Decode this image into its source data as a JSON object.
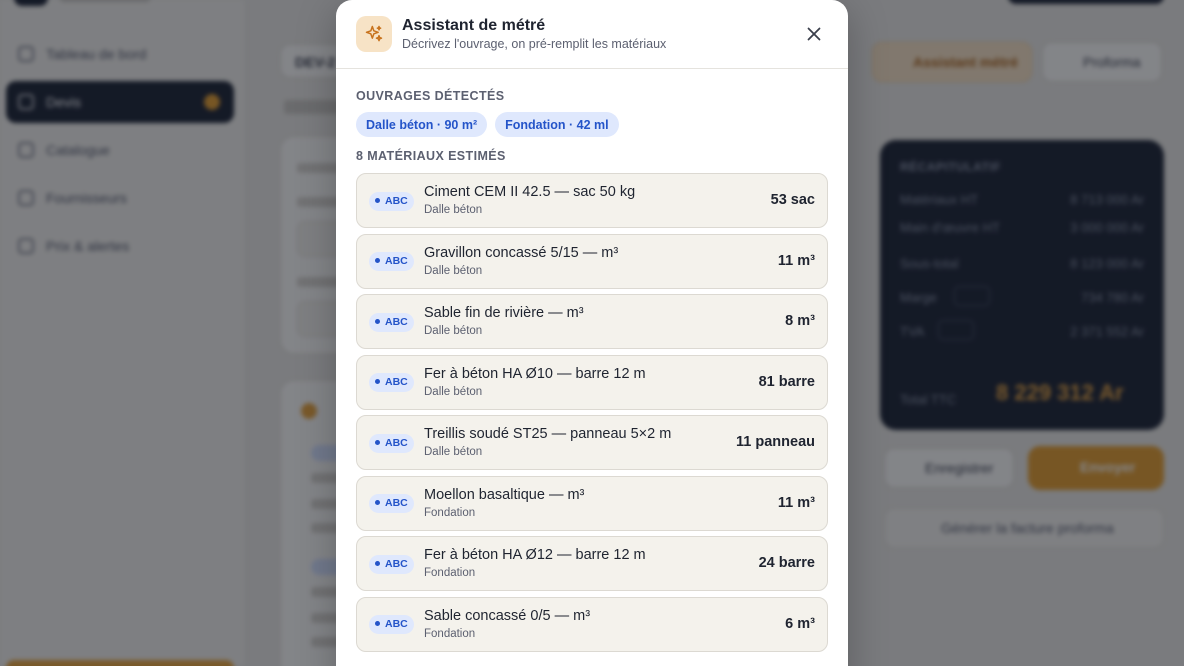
{
  "background": {
    "sidebar": {
      "items": [
        {
          "label": "Tableau de bord",
          "icon": "grid-icon"
        },
        {
          "label": "Devis",
          "icon": "document-icon",
          "active": true
        },
        {
          "label": "Catalogue",
          "icon": "box-icon"
        },
        {
          "label": "Fournisseurs",
          "icon": "truck-icon"
        },
        {
          "label": "Prix & alertes",
          "icon": "trend-icon"
        }
      ]
    },
    "main": {
      "doc_title": "DEV-2",
      "ai_button": "Assistant métré",
      "proforma_button": "Proforma",
      "recap": {
        "title": "RÉCAPITULATIF",
        "lines": [
          {
            "label": "Matériaux HT",
            "value": "8 713 000 Ar"
          },
          {
            "label": "Main d'œuvre HT",
            "value": "3 000 000 Ar"
          },
          {
            "label": "Sous-total",
            "value": "8 123 000 Ar"
          },
          {
            "label": "Marge",
            "value": "734 780 Ar"
          },
          {
            "label": "TVA",
            "value": "2 371 552 Ar"
          }
        ],
        "total_label": "Total TTC",
        "total_value": "8 229 312 Ar"
      },
      "save_button": "Enregistrer",
      "send_button": "Envoyer",
      "generate_button": "Générer la facture proforma"
    }
  },
  "modal": {
    "title": "Assistant de métré",
    "subtitle": "Décrivez l'ouvrage, on pré-remplit les matériaux",
    "icon": "sparkle-icon",
    "close_icon": "close-icon",
    "detected_label": "OUVRAGES DÉTECTÉS",
    "detected": [
      "Dalle béton · 90 m²",
      "Fondation · 42 ml"
    ],
    "materials_label": "8 MATÉRIAUX ESTIMÉS",
    "materials": [
      {
        "badge": "ABC",
        "name": "Ciment CEM II 42.5 — sac 50 kg",
        "work": "Dalle béton",
        "qty": "53 sac"
      },
      {
        "badge": "ABC",
        "name": "Gravillon concassé 5/15 — m³",
        "work": "Dalle béton",
        "qty": "11 m³"
      },
      {
        "badge": "ABC",
        "name": "Sable fin de rivière — m³",
        "work": "Dalle béton",
        "qty": "8 m³"
      },
      {
        "badge": "ABC",
        "name": "Fer à béton HA Ø10 — barre 12 m",
        "work": "Dalle béton",
        "qty": "81 barre"
      },
      {
        "badge": "ABC",
        "name": "Treillis soudé ST25 — panneau 5×2 m",
        "work": "Dalle béton",
        "qty": "11 panneau"
      },
      {
        "badge": "ABC",
        "name": "Moellon basaltique — m³",
        "work": "Fondation",
        "qty": "11 m³"
      },
      {
        "badge": "ABC",
        "name": "Fer à béton HA Ø12 — barre 12 m",
        "work": "Fondation",
        "qty": "24 barre"
      },
      {
        "badge": "ABC",
        "name": "Sable concassé 0/5 — m³",
        "work": "Fondation",
        "qty": "6 m³"
      }
    ]
  }
}
